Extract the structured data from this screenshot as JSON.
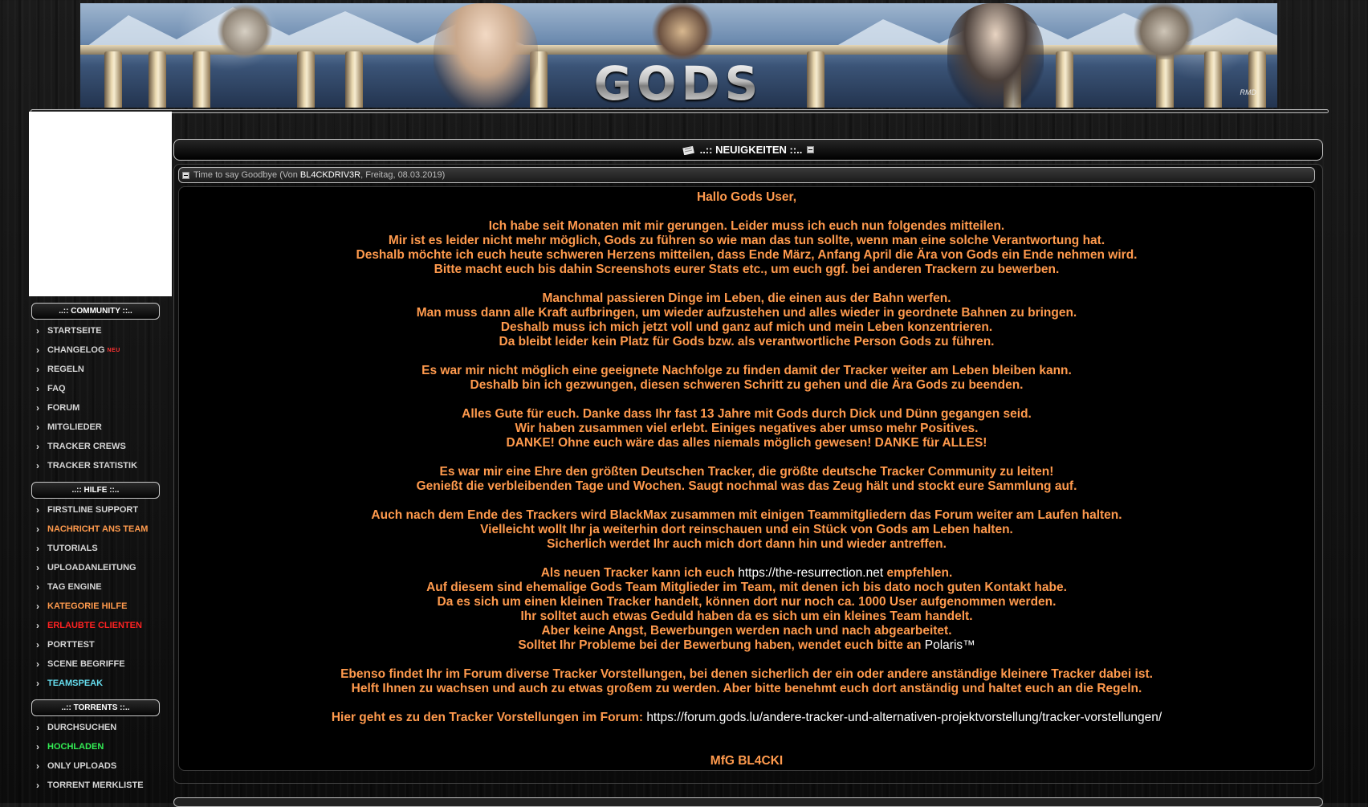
{
  "banner": {
    "logo_text": "GODS",
    "signature": "RMD"
  },
  "sidebar": {
    "sections": [
      {
        "title": "..:: COMMUNITY ::..",
        "items": [
          {
            "label": "STARTSEITE",
            "badge": ""
          },
          {
            "label": "CHANGELOG",
            "badge": "NEU"
          },
          {
            "label": "REGELN",
            "badge": ""
          },
          {
            "label": "FAQ",
            "badge": ""
          },
          {
            "label": "FORUM",
            "badge": ""
          },
          {
            "label": "MITGLIEDER",
            "badge": ""
          },
          {
            "label": "TRACKER CREWS",
            "badge": ""
          },
          {
            "label": "TRACKER STATISTIK",
            "badge": ""
          }
        ]
      },
      {
        "title": "..:: HILFE ::..",
        "items": [
          {
            "label": "FIRSTLINE SUPPORT",
            "color": ""
          },
          {
            "label": "NACHRICHT ANS TEAM",
            "color": "orange"
          },
          {
            "label": "TUTORIALS",
            "color": ""
          },
          {
            "label": "UPLOADANLEITUNG",
            "color": ""
          },
          {
            "label": "TAG ENGINE",
            "color": ""
          },
          {
            "label": "KATEGORIE HILFE",
            "color": "orange"
          },
          {
            "label": "ERLAUBTE CLIENTEN",
            "color": "red"
          },
          {
            "label": "PORTTEST",
            "color": ""
          },
          {
            "label": "SCENE BEGRIFFE",
            "color": ""
          },
          {
            "label": "TEAMSPEAK",
            "color": "cyan"
          }
        ]
      },
      {
        "title": "..:: TORRENTS ::..",
        "items": [
          {
            "label": "DURCHSUCHEN",
            "color": ""
          },
          {
            "label": "HOCHLADEN",
            "color": "green"
          },
          {
            "label": "ONLY UPLOADS",
            "color": ""
          },
          {
            "label": "TORRENT MERKLISTE",
            "color": ""
          }
        ]
      }
    ]
  },
  "news": {
    "title": "..:: NEUIGKEITEN ::..",
    "article": {
      "title": "Time to say Goodbye",
      "by_prefix": "(Von",
      "author": "BL4CKDRIV3R",
      "date": ", Freitag, 08.03.2019)"
    },
    "body": {
      "greeting": "Hallo Gods User,",
      "p1": [
        "Ich habe seit Monaten mit mir gerungen. Leider muss ich euch nun folgendes mitteilen.",
        "Mir ist es leider nicht mehr möglich, Gods zu führen so wie man das tun sollte, wenn man eine solche Verantwortung hat.",
        "Deshalb möchte ich euch heute schweren Herzens mitteilen, dass Ende März, Anfang April die Ära von Gods ein Ende nehmen wird.",
        "Bitte macht euch bis dahin Screenshots eurer Stats etc., um euch ggf. bei anderen Trackern zu bewerben."
      ],
      "p2": [
        "Manchmal passieren Dinge im Leben, die einen aus der Bahn werfen.",
        "Man muss dann alle Kraft aufbringen, um wieder aufzustehen und alles wieder in geordnete Bahnen zu bringen.",
        "Deshalb muss ich mich jetzt voll und ganz auf mich und mein Leben konzentrieren.",
        "Da bleibt leider kein Platz für Gods bzw. als verantwortliche Person Gods zu führen."
      ],
      "p3": [
        "Es war mir nicht möglich eine geeignete Nachfolge zu finden damit der Tracker weiter am Leben bleiben kann.",
        "Deshalb bin ich gezwungen, diesen schweren Schritt zu gehen und die Ära Gods zu beenden."
      ],
      "p4": [
        "Alles Gute für euch. Danke dass Ihr fast 13 Jahre mit Gods durch Dick und Dünn gegangen seid.",
        "Wir haben zusammen viel erlebt. Einiges negatives aber umso mehr Positives.",
        "DANKE! Ohne euch wäre das alles niemals möglich gewesen! DANKE für ALLES!"
      ],
      "p5": [
        "Es war mir eine Ehre den größten Deutschen Tracker, die größte deutsche Tracker Community zu leiten!",
        "Genießt die verbleibenden Tage und Wochen. Saugt nochmal was das Zeug hält und stockt eure Sammlung auf."
      ],
      "p6": [
        "Auch nach dem Ende des Trackers wird BlackMax zusammen mit einigen Teammitgliedern das Forum weiter am Laufen halten.",
        "Vielleicht wollt Ihr ja weiterhin dort reinschauen und ein Stück von Gods am Leben halten.",
        "Sicherlich werdet Ihr auch mich dort dann hin und wieder antreffen."
      ],
      "p7_pre": "Als neuen Tracker kann ich euch",
      "p7_link": "https://the-resurrection.net",
      "p7_post": "empfehlen.",
      "p7_lines": [
        "Auf diesem sind ehemalige Gods Team Mitglieder im Team, mit denen ich bis dato noch guten Kontakt habe.",
        "Da es sich um einen kleinen Tracker handelt, können dort nur noch ca. 1000 User aufgenommen werden.",
        "Ihr solltet auch etwas Geduld haben da es sich um ein kleines Team handelt.",
        "Aber keine Angst, Bewerbungen werden nach und nach abgearbeitet."
      ],
      "p7_last_pre": "Solltet Ihr Probleme bei der Bewerbung haben, wendet euch bitte an",
      "p7_last_link": "Polaris™",
      "p8": [
        "Ebenso findet Ihr im Forum diverse Tracker Vorstellungen, bei denen sicherlich der ein oder andere anständige kleinere Tracker dabei ist.",
        "Helft Ihnen zu wachsen und auch zu etwas großem zu werden. Aber bitte benehmt euch dort anständig und haltet euch an die Regeln."
      ],
      "p9_pre": "Hier geht es zu den Tracker Vorstellungen im Forum:",
      "p9_link": "https://forum.gods.lu/andere-tracker-und-alternativen-projektvorstellung/tracker-vorstellungen/",
      "signoff": "MfG BL4CKI"
    }
  }
}
